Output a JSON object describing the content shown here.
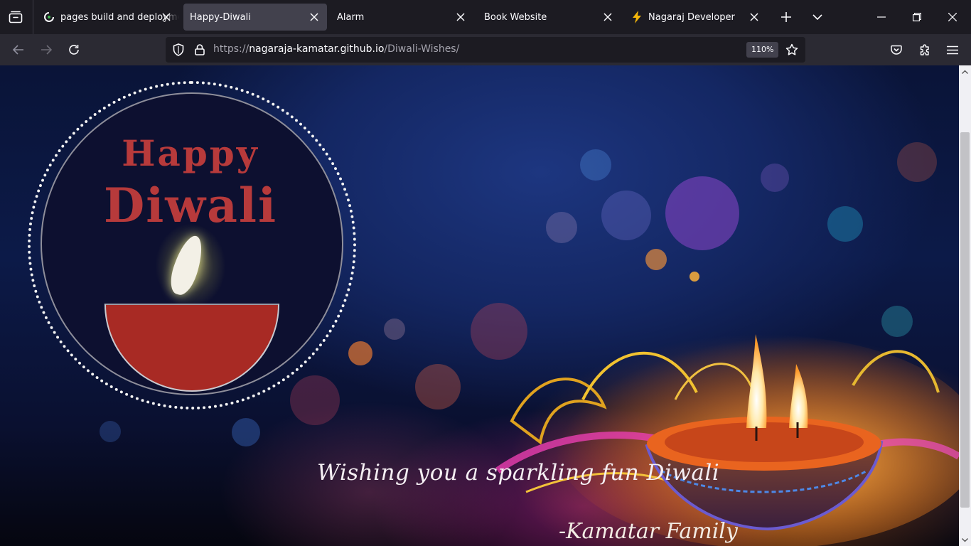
{
  "tabs": [
    {
      "title": "pages build and deployment",
      "icon": "github-actions-icon",
      "active": false
    },
    {
      "title": "Happy-Diwali",
      "icon": "",
      "active": true
    },
    {
      "title": "Alarm",
      "icon": "",
      "active": false
    },
    {
      "title": "Book Website",
      "icon": "",
      "active": false
    },
    {
      "title": "Nagaraj Developer",
      "icon": "lightning-bolt-icon",
      "active": false
    }
  ],
  "urlbar": {
    "scheme": "https://",
    "host": "nagaraja-kamatar.github.io",
    "path": "/Diwali-Wishes/",
    "zoom": "110%"
  },
  "page": {
    "greeting_line1": "Happy",
    "greeting_line2": "Diwali",
    "wish": "Wishing you a sparkling fun Diwali",
    "signature": "-Kamatar Family"
  },
  "colors": {
    "greeting_red": "#b73a3b",
    "diya_bowl": "#a82a24",
    "toolbar": "#2b2a33",
    "tabstrip": "#1c1b22"
  }
}
